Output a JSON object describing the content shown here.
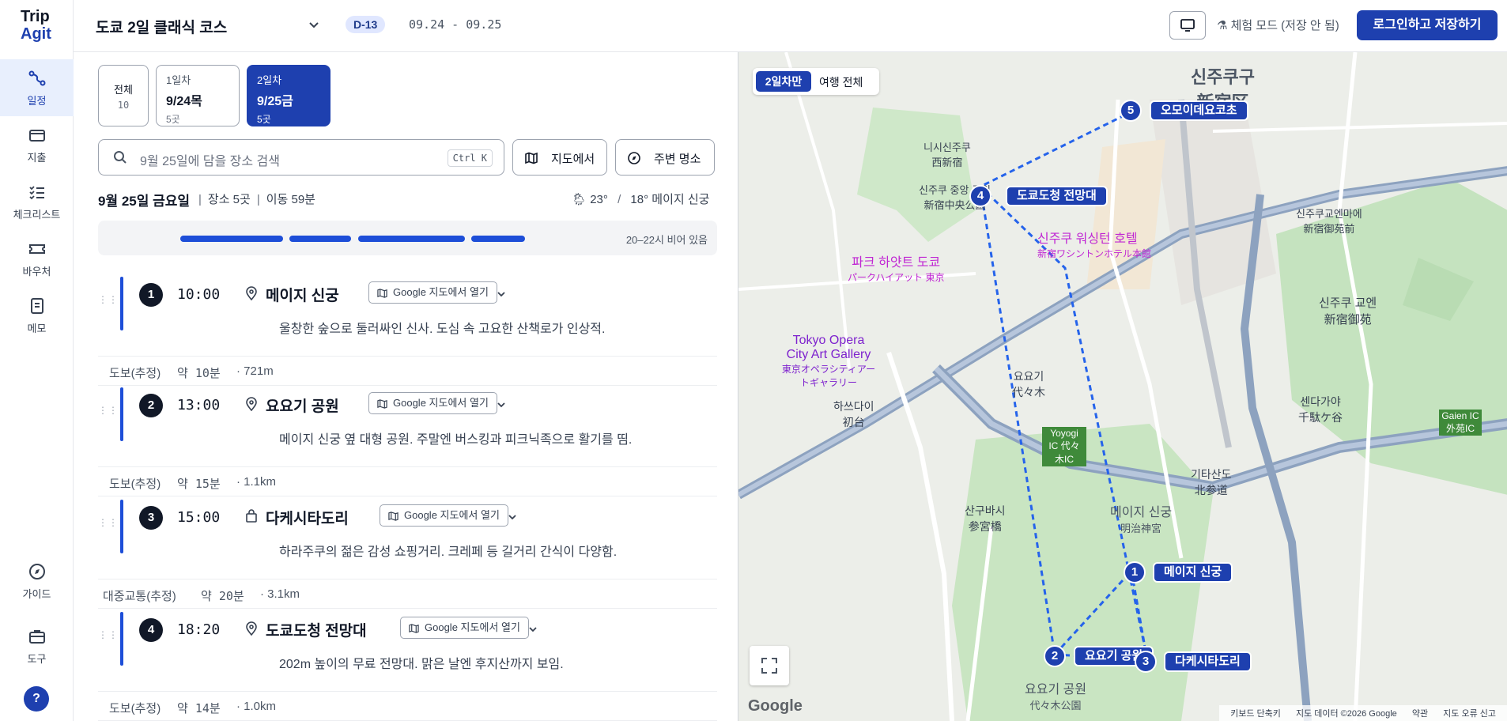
{
  "app": {
    "logo_line1": "Trip",
    "logo_line2": "Agit"
  },
  "sidebar": {
    "items": [
      {
        "label": "일정",
        "icon": "route-icon"
      },
      {
        "label": "지출",
        "icon": "wallet-icon"
      },
      {
        "label": "체크리스트",
        "icon": "checklist-icon"
      },
      {
        "label": "바우처",
        "icon": "ticket-icon"
      },
      {
        "label": "메모",
        "icon": "memo-icon"
      }
    ],
    "bottom_items": [
      {
        "label": "가이드",
        "icon": "compass-icon"
      },
      {
        "label": "도구",
        "icon": "briefcase-icon"
      }
    ],
    "help_label": "?"
  },
  "header": {
    "trip_title": "도쿄 2일 클래식 코스",
    "dday": "D-13",
    "dates": "09.24 - 09.25",
    "experience_mode": "체험 모드 (저장 안 됨)",
    "login_button": "로그인하고 저장하기"
  },
  "day_tabs": [
    {
      "line1": "전체",
      "line2": "",
      "line3": "10"
    },
    {
      "line1": "1일차",
      "line2": "9/24목",
      "line3": "5곳"
    },
    {
      "line1": "2일차",
      "line2": "9/25금",
      "line3": "5곳"
    }
  ],
  "search": {
    "placeholder": "9월 25일에 담을 장소 검색",
    "shortcut": "Ctrl K"
  },
  "tools": {
    "map_button": "지도에서",
    "nearby_button": "주변 명소"
  },
  "day_summary": {
    "title": "9월 25일 금요일",
    "places": "장소 5곳",
    "travel": "이동 59분",
    "temp_high": "23°",
    "temp_sep": "/",
    "temp_low": "18°",
    "weather_place": "메이지 신궁"
  },
  "timeline": {
    "free_text": "20–22시 비어 있음"
  },
  "stops": [
    {
      "num": "1",
      "time": "10:00",
      "name": "메이지 신궁",
      "icon": "pin-icon",
      "gmap": "Google 지도에서 열기",
      "desc": "울창한 숲으로 둘러싸인 신사. 도심 속 고요한 산책로가 인상적."
    },
    {
      "num": "2",
      "time": "13:00",
      "name": "요요기 공원",
      "icon": "pin-icon",
      "gmap": "Google 지도에서 열기",
      "desc": "메이지 신궁 옆 대형 공원. 주말엔 버스킹과 피크닉족으로 활기를 띰."
    },
    {
      "num": "3",
      "time": "15:00",
      "name": "다케시타도리",
      "icon": "bag-icon",
      "gmap": "Google 지도에서 열기",
      "desc": "하라주쿠의 젊은 감성 쇼핑거리. 크레페 등 길거리 간식이 다양함."
    },
    {
      "num": "4",
      "time": "18:20",
      "name": "도쿄도청 전망대",
      "icon": "pin-icon",
      "gmap": "Google 지도에서 열기",
      "desc": "202m 높이의 무료 전망대. 맑은 날엔 후지산까지 보임."
    }
  ],
  "legs": [
    {
      "mode": "도보(추정)",
      "duration": "약 10분",
      "distance": "· 721m"
    },
    {
      "mode": "도보(추정)",
      "duration": "약 15분",
      "distance": "· 1.1km"
    },
    {
      "mode": "대중교통(추정)",
      "duration": "약 20분",
      "distance": "· 3.1km"
    },
    {
      "mode": "도보(추정)",
      "duration": "약 14분",
      "distance": "· 1.0km"
    }
  ],
  "map": {
    "toggle_active": "2일차만",
    "toggle_other": "여행 전체",
    "markers": [
      {
        "num": "1",
        "label": "메이지 신궁"
      },
      {
        "num": "2",
        "label": "요요기 공원"
      },
      {
        "num": "3",
        "label": "다케시타도리"
      },
      {
        "num": "4",
        "label": "도쿄도청 전망대"
      },
      {
        "num": "5",
        "label": "오모이데요코초"
      }
    ],
    "labels": {
      "shinjuku_ku": "신주쿠구",
      "shinjuku_ku_jp": "新宿区",
      "nishi_shinjuku": "니시신주쿠",
      "nishi_shinjuku_jp": "西新宿",
      "gyoen": "신주쿠 교엔",
      "gyoen_jp": "新宿御苑",
      "yoyogi": "요요기",
      "yoyogi_jp": "代々木",
      "sendagaya": "센다가야",
      "sendagaya_jp": "千駄ケ谷",
      "meiji_shrine": "메이지 신궁",
      "meiji_shrine_jp": "明治神宮",
      "yoyogi_park": "요요기 공원",
      "yoyogi_park_jp": "代々木公園",
      "park_hyatt": "파크 하얏트 도쿄",
      "park_hyatt_jp": "パークハイアット 東京",
      "washington": "신주쿠 워싱턴 호텔",
      "washington_jp": "新宿ワシントンホテル本館",
      "opera": "Tokyo Opera City Art Gallery",
      "opera_jp": "東京オペラシティアートギャラリー",
      "sangubashi": "산구바시",
      "sangubashi_jp": "参宮橋",
      "kitasando": "기타산도",
      "kitasando_jp": "北参道",
      "hatsudai": "하쓰다이",
      "hatsudai_jp": "初台",
      "gyoenmae": "신주쿠교엔마에",
      "gyoenmae_jp": "新宿御苑前",
      "central_park": "신주쿠 중앙 공원",
      "central_park_jp": "新宿中央公園",
      "yoyogi_ic": "Yoyogi IC 代々木IC",
      "gaien_ic": "Gaien IC 外苑IC"
    },
    "attribution": [
      "키보드 단축키",
      "지도 데이터 ©2026 Google",
      "약관",
      "지도 오류 신고"
    ],
    "google": "Google"
  }
}
